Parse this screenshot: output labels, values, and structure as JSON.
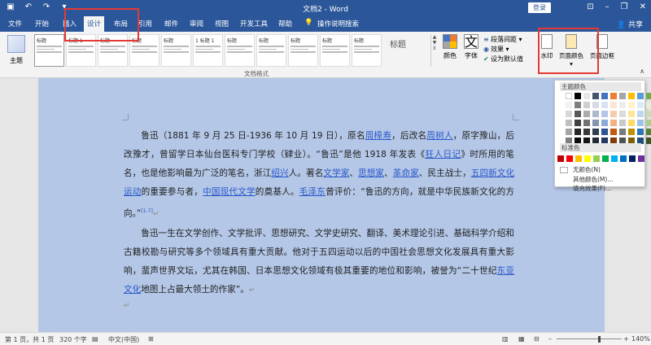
{
  "window": {
    "title": "文档2 - Word",
    "login_label": "登录",
    "qa_icons": [
      "save-icon",
      "undo-icon",
      "redo-icon",
      "customize-icon"
    ],
    "controls": [
      "ribbon-display-icon",
      "minimize-icon",
      "restore-icon",
      "close-icon"
    ]
  },
  "tabs": [
    {
      "label": "文件"
    },
    {
      "label": "开始"
    },
    {
      "label": "插入"
    },
    {
      "label": "设计"
    },
    {
      "label": "布局"
    },
    {
      "label": "引用"
    },
    {
      "label": "邮件"
    },
    {
      "label": "审阅"
    },
    {
      "label": "视图"
    },
    {
      "label": "开发工具"
    },
    {
      "label": "帮助"
    }
  ],
  "tell_me": "操作说明搜索",
  "share_label": "共享",
  "ribbon": {
    "theme_label": "主题",
    "style_thumbs": [
      {
        "head": "标题"
      },
      {
        "head": "标题 1"
      },
      {
        "head": "标题"
      },
      {
        "head": "标题"
      },
      {
        "head": "标题"
      },
      {
        "head": "1 标题 1"
      },
      {
        "head": "标题"
      },
      {
        "head": "标题"
      },
      {
        "head": "标题"
      },
      {
        "head": "标题"
      },
      {
        "head": "标题"
      }
    ],
    "style_big": [
      "标题"
    ],
    "group_label": "文档格式",
    "colors_label": "颜色",
    "fonts_label": "字体",
    "para_spacing": "段落间距",
    "effects": "效果",
    "set_default": "设为默认值",
    "watermark_label": "水印",
    "page_color_label": "页面颜色",
    "page_border_label": "页面边框"
  },
  "document": {
    "para1": [
      {
        "t": "鲁迅（1881 年 9 月 25 日-1936 年 10 月 19 日），原名"
      },
      {
        "t": "周樟寿",
        "link": true
      },
      {
        "t": "，后改名"
      },
      {
        "t": "周树人",
        "link": true
      },
      {
        "t": "，原字豫山，后改豫才，曾留学日本仙台医科专门学校（肄业）。“鲁迅”是他 1918 年发表《"
      },
      {
        "t": "狂人日记",
        "link": true
      },
      {
        "t": "》时所用的笔名，也是他影响最为广泛的笔名，浙江"
      },
      {
        "t": "绍兴",
        "link": true
      },
      {
        "t": "人。著名"
      },
      {
        "t": "文学家",
        "link": true
      },
      {
        "t": "、"
      },
      {
        "t": "思想家",
        "link": true
      },
      {
        "t": "、"
      },
      {
        "t": "革命家",
        "link": true
      },
      {
        "t": "、民主战士，"
      },
      {
        "t": "五四新文化运动",
        "link": true
      },
      {
        "t": "的重要参与者，"
      },
      {
        "t": "中国现代文学",
        "link": true
      },
      {
        "t": "的奠基人。"
      },
      {
        "t": "毛泽东",
        "link": true
      },
      {
        "t": "曾评价：“鲁迅的方向，就是中华民族新文化的方向。”"
      },
      {
        "t": "[1-7]",
        "sup": true
      }
    ],
    "para2": [
      {
        "t": "鲁迅一生在文学创作、文学批评、思想研究、文学史研究、翻译、美术理论引进、基础科学介绍和古籍校勘与研究等多个领域具有重大贡献。他对于五四运动以后的中国社会思想文化发展具有重大影响，蜚声世界文坛，尤其在韩国、日本思想文化领域有极其重要的地位和影响，被誉为“二十世纪"
      },
      {
        "t": "东亚文化",
        "link": true
      },
      {
        "t": "地图上占最大领土的作家”。"
      }
    ],
    "para_mark": "↵"
  },
  "status": {
    "page": "第 1 页，共 1 页",
    "words": "320 个字",
    "lang": "中文(中国)",
    "zoom": "140%"
  },
  "dropdown": {
    "theme_colors_title": "主题颜色",
    "standard_colors_title": "标准色",
    "no_color": "无颜色(N)",
    "more_colors": "其他颜色(M)...",
    "fill_effects": "填充效果(F)...",
    "theme_colors": [
      [
        "#ffffff",
        "#000000",
        "#e7e6e6",
        "#44546a",
        "#4472c4",
        "#ed7d31",
        "#a5a5a5",
        "#ffc000",
        "#5b9bd5",
        "#70ad47"
      ],
      [
        "#f2f2f2",
        "#7f7f7f",
        "#d0cece",
        "#d6dce4",
        "#d9e2f3",
        "#fbe5d5",
        "#ededed",
        "#fff2cc",
        "#deebf6",
        "#e2efd9"
      ],
      [
        "#d8d8d8",
        "#595959",
        "#aeabab",
        "#adb9ca",
        "#b4c6e7",
        "#f7cbac",
        "#dbdbdb",
        "#fee599",
        "#bdd7ee",
        "#c5e0b3"
      ],
      [
        "#bfbfbf",
        "#3f3f3f",
        "#757070",
        "#8496b0",
        "#8eaadb",
        "#f4b183",
        "#c9c9c9",
        "#ffd965",
        "#9cc3e5",
        "#a8d08d"
      ],
      [
        "#a5a5a5",
        "#262626",
        "#3a3838",
        "#323f4f",
        "#2f5496",
        "#c55a11",
        "#7b7b7b",
        "#bf9000",
        "#2e75b5",
        "#538135"
      ],
      [
        "#7f7f7f",
        "#0c0c0c",
        "#171616",
        "#222a35",
        "#1f3864",
        "#833c0b",
        "#525252",
        "#7f6000",
        "#1e4e79",
        "#375623"
      ]
    ],
    "standard_colors": [
      "#c00000",
      "#ff0000",
      "#ffc000",
      "#ffff00",
      "#92d050",
      "#00b050",
      "#00b0f0",
      "#0070c0",
      "#002060",
      "#7030a0"
    ]
  }
}
